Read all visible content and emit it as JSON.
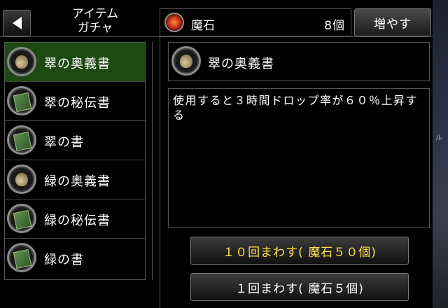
{
  "header": {
    "title_line1": "アイテム",
    "title_line2": "ガチャ",
    "stone_label": "魔石",
    "stone_count": "8個",
    "increase_label": "増やす"
  },
  "items": [
    {
      "label": "翠の奥義書",
      "icon": "sack-icon",
      "selected": true
    },
    {
      "label": "翠の秘伝書",
      "icon": "book-icon"
    },
    {
      "label": "翠の書",
      "icon": "book-icon"
    },
    {
      "label": "緑の奥義書",
      "icon": "sack-icon"
    },
    {
      "label": "緑の秘伝書",
      "icon": "book-icon"
    },
    {
      "label": "緑の書",
      "icon": "book-icon"
    }
  ],
  "detail": {
    "name": "翠の奥義書",
    "description": "使用すると３時間ドロップ率が６０％上昇する"
  },
  "buttons": {
    "spin10": "１０回まわす( 魔石５０個)",
    "spin1": "１回まわす( 魔石５個)"
  },
  "colors": {
    "selected_bg": "#1d4a12",
    "spin10_text": "#ffe14a"
  }
}
